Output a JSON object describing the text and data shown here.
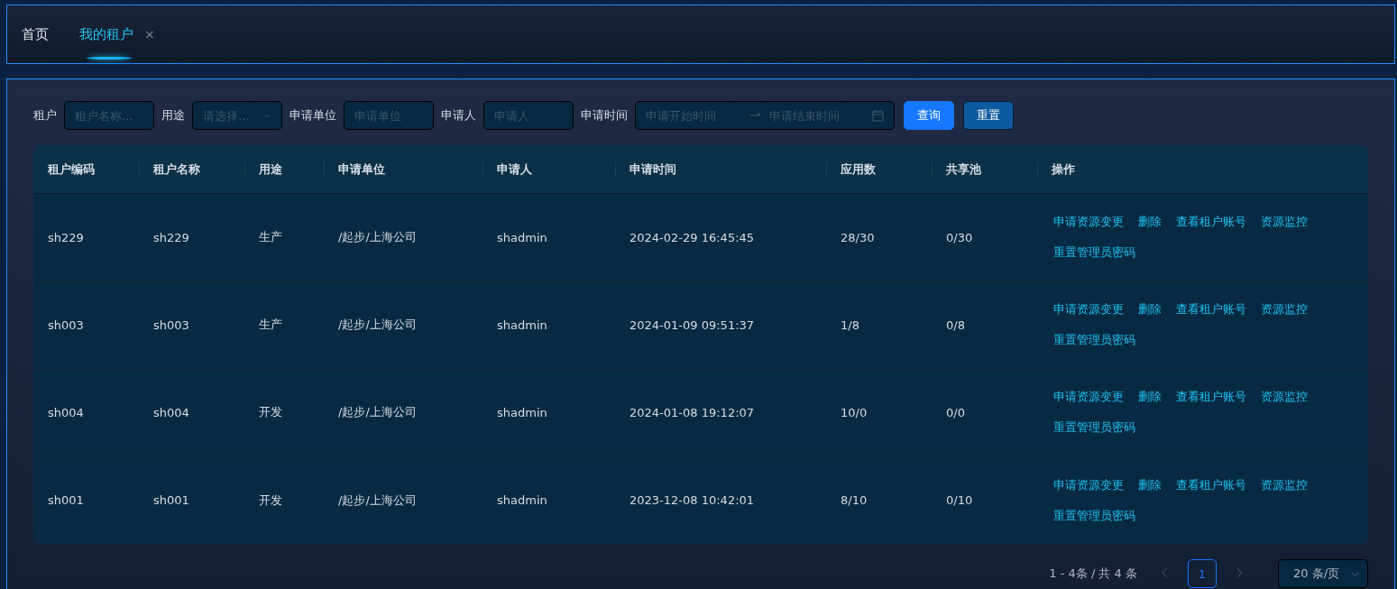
{
  "tabs": [
    {
      "label": "首页",
      "selected": false
    },
    {
      "label": "我的租户",
      "selected": true,
      "close": "×"
    }
  ],
  "filters": [
    {
      "kind": "input",
      "label": "租户",
      "placeholder": "租户名称..."
    },
    {
      "kind": "select",
      "label": "用途",
      "placeholder": "请选择..."
    },
    {
      "kind": "input",
      "label": "申请单位",
      "placeholder": "申请单位"
    },
    {
      "kind": "input",
      "label": "申请人",
      "placeholder": "申请人"
    },
    {
      "kind": "range",
      "label": "申请时间",
      "placeholder": "申请开始时间",
      "placeholder_end": "申请结束时间"
    }
  ],
  "buttons": [
    {
      "label": "查询",
      "primary": true
    },
    {
      "label": "重置",
      "primary": false
    }
  ],
  "table": {
    "columns": [
      "租户编码",
      "租户名称",
      "用途",
      "申请单位",
      "申请人",
      "申请时间",
      "应用数",
      "共享池",
      "操作"
    ],
    "rows": [
      {
        "cells": [
          "sh229",
          "sh229",
          "生产",
          "/起步/上海公司",
          "shadmin",
          "2024-02-29 16:45:45",
          "28/30",
          "0/30"
        ],
        "actions": [
          "申请资源变更",
          "删除",
          "查看租户账号",
          "资源监控",
          "重置管理员密码"
        ]
      },
      {
        "cells": [
          "sh003",
          "sh003",
          "生产",
          "/起步/上海公司",
          "shadmin",
          "2024-01-09 09:51:37",
          "1/8",
          "0/8"
        ],
        "actions": [
          "申请资源变更",
          "删除",
          "查看租户账号",
          "资源监控",
          "重置管理员密码"
        ]
      },
      {
        "cells": [
          "sh004",
          "sh004",
          "开发",
          "/起步/上海公司",
          "shadmin",
          "2024-01-08 19:12:07",
          "10/0",
          "0/0"
        ],
        "actions": [
          "申请资源变更",
          "删除",
          "查看租户账号",
          "资源监控",
          "重置管理员密码"
        ]
      },
      {
        "cells": [
          "sh001",
          "sh001",
          "开发",
          "/起步/上海公司",
          "shadmin",
          "2023-12-08 10:42:01",
          "8/10",
          "0/10"
        ],
        "actions": [
          "申请资源变更",
          "删除",
          "查看租户账号",
          "资源监控",
          "重置管理员密码"
        ]
      }
    ]
  },
  "pagination": {
    "summary": "1 - 4条 / 共 4 条",
    "pages": [
      {
        "label": "1",
        "selected": true
      }
    ],
    "page_size": "20 条/页"
  }
}
